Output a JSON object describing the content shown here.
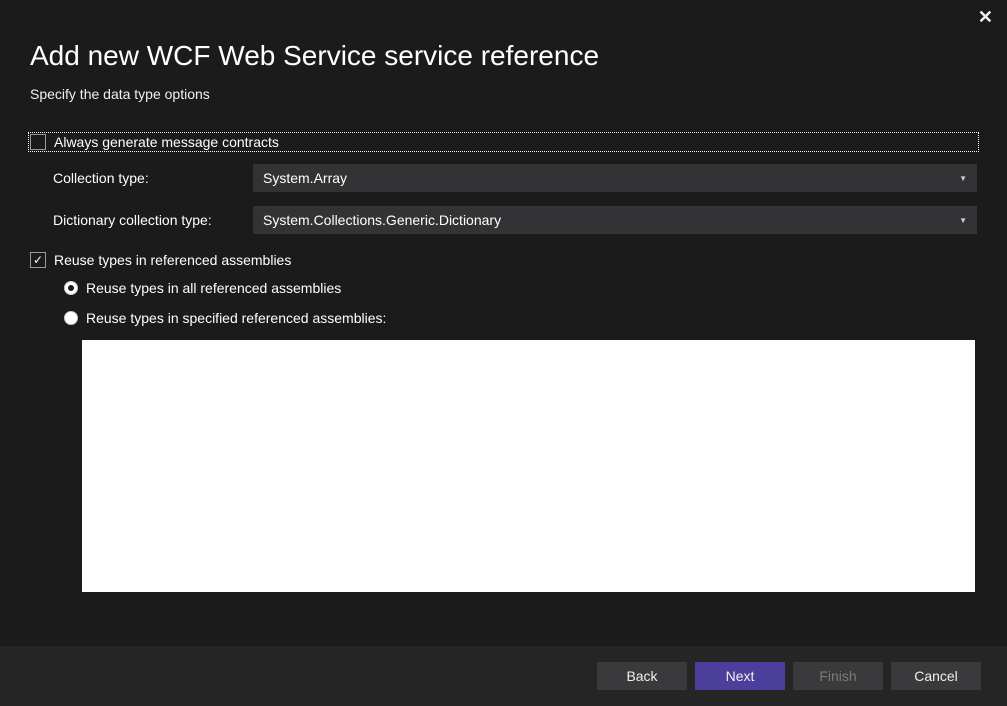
{
  "header": {
    "title": "Add new WCF Web Service service reference",
    "subtitle": "Specify the data type options"
  },
  "options": {
    "always_generate_label": "Always generate message contracts",
    "collection_type_label": "Collection type:",
    "collection_type_value": "System.Array",
    "dictionary_type_label": "Dictionary collection type:",
    "dictionary_type_value": "System.Collections.Generic.Dictionary",
    "reuse_types_label": "Reuse types in referenced assemblies",
    "reuse_all_label": "Reuse types in all referenced assemblies",
    "reuse_specified_label": "Reuse types in specified referenced assemblies:"
  },
  "footer": {
    "back": "Back",
    "next": "Next",
    "finish": "Finish",
    "cancel": "Cancel"
  }
}
